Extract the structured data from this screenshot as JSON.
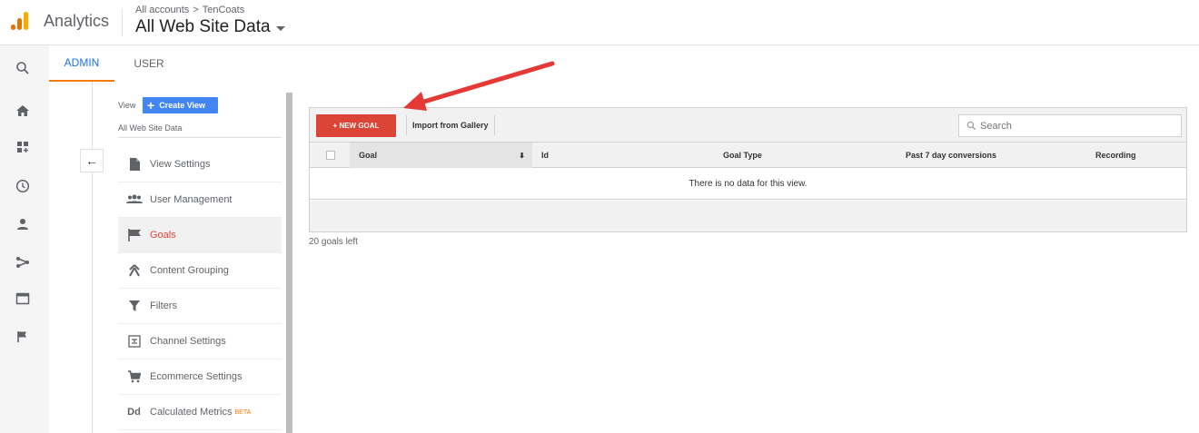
{
  "header": {
    "app_name": "Analytics",
    "breadcrumb": [
      "All accounts",
      "TenCoats"
    ],
    "breadcrumb_separator": ">",
    "account_title": "All Web Site Data"
  },
  "rail": {
    "icons": [
      "search-icon",
      "home-icon",
      "customization-icon",
      "clock-icon",
      "person-icon",
      "acquisition-icon",
      "behavior-icon",
      "flag-icon"
    ]
  },
  "tabs": {
    "admin": "ADMIN",
    "user": "USER"
  },
  "view_column": {
    "view_label": "View",
    "create_view_label": "Create View",
    "view_name": "All Web Site Data",
    "back_label": "←",
    "menu": [
      {
        "label": "View Settings",
        "icon": "document-icon",
        "active": false
      },
      {
        "label": "User Management",
        "icon": "people-icon",
        "active": false
      },
      {
        "label": "Goals",
        "icon": "flag-icon",
        "active": true
      },
      {
        "label": "Content Grouping",
        "icon": "content-grouping-icon",
        "active": false
      },
      {
        "label": "Filters",
        "icon": "filter-icon",
        "active": false
      },
      {
        "label": "Channel Settings",
        "icon": "channel-icon",
        "active": false
      },
      {
        "label": "Ecommerce Settings",
        "icon": "cart-icon",
        "active": false
      },
      {
        "label": "Calculated Metrics",
        "icon": "dd-icon",
        "active": false,
        "badge": "BETA"
      }
    ],
    "dd_glyph": "Dd"
  },
  "goals_table": {
    "new_goal_label": "+ NEW GOAL",
    "import_label": "Import from Gallery",
    "search_placeholder": "Search",
    "columns": {
      "goal": "Goal",
      "id": "Id",
      "goal_type": "Goal Type",
      "past_7_day": "Past 7 day conversions",
      "recording": "Recording"
    },
    "empty_message": "There is no data for this view.",
    "goals_left": "20 goals left"
  },
  "colors": {
    "accent_blue": "#1a73e8",
    "tab_underline": "#f57c00",
    "new_goal_red": "#db4437",
    "create_view_blue": "#4285f4",
    "arrow_red": "#e53935"
  }
}
